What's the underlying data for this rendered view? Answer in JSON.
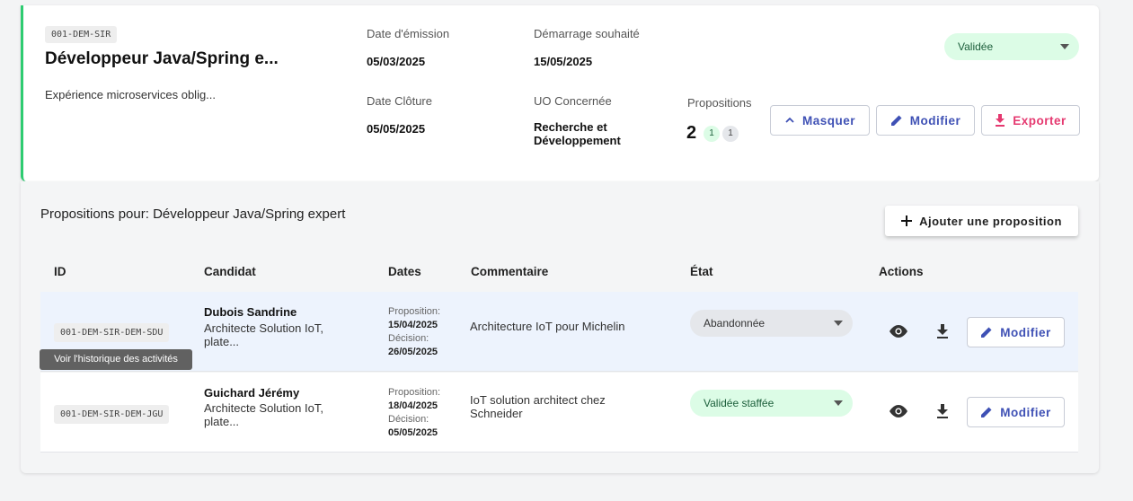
{
  "request": {
    "code": "001-DEM-SIR",
    "title": "Développeur Java/Spring e...",
    "description": "Expérience microservices oblig...",
    "date_emission_label": "Date d'émission",
    "date_emission": "05/03/2025",
    "demarrage_label": "Démarrage souhaité",
    "demarrage": "15/05/2025",
    "date_cloture_label": "Date Clôture",
    "date_cloture": "05/05/2025",
    "uo_label": "UO Concernée",
    "uo_line1": "Recherche et",
    "uo_line2": "Développement",
    "propositions_label": "Propositions",
    "propositions_count": "2",
    "badge_green": "1",
    "badge_grey": "1",
    "status": "Validée",
    "buttons": {
      "masquer": "Masquer",
      "modifier": "Modifier",
      "exporter": "Exporter"
    }
  },
  "panel": {
    "title": "Propositions pour: Développeur Java/Spring expert",
    "add_button": "Ajouter une proposition",
    "columns": [
      "ID",
      "Candidat",
      "Dates",
      "Commentaire",
      "État",
      "Actions"
    ],
    "rows": [
      {
        "id": "001-DEM-SIR-DEM-SDU",
        "name": "Dubois Sandrine",
        "role_line1": "Architecte Solution IoT,",
        "role_line2": "plate...",
        "prop_label": "Proposition:",
        "prop_date": "15/04/2025",
        "dec_label": "Décision:",
        "dec_date": "26/05/2025",
        "comment_line1": "Architecture IoT pour Michelin",
        "comment_line2": "",
        "etat": "Abandonnée",
        "modify": "Modifier"
      },
      {
        "id": "001-DEM-SIR-DEM-JGU",
        "name": "Guichard Jérémy",
        "role_line1": "Architecte Solution IoT,",
        "role_line2": "plate...",
        "prop_label": "Proposition:",
        "prop_date": "18/04/2025",
        "dec_label": "Décision:",
        "dec_date": "05/05/2025",
        "comment_line1": "IoT solution architect chez",
        "comment_line2": "Schneider",
        "etat": "Validée staffée",
        "modify": "Modifier"
      }
    ],
    "tooltip": "Voir l'historique des activités"
  },
  "colors": {
    "accent_green": "#2ecc71",
    "primary": "#3f51b5",
    "danger": "#e53970",
    "validee_bg": "#dcfce6",
    "abandon_bg": "#e5e7eb"
  },
  "icons": [
    "chevron-up-icon",
    "pencil-icon",
    "download-icon",
    "plus-icon",
    "eye-icon",
    "caret-down-icon"
  ]
}
